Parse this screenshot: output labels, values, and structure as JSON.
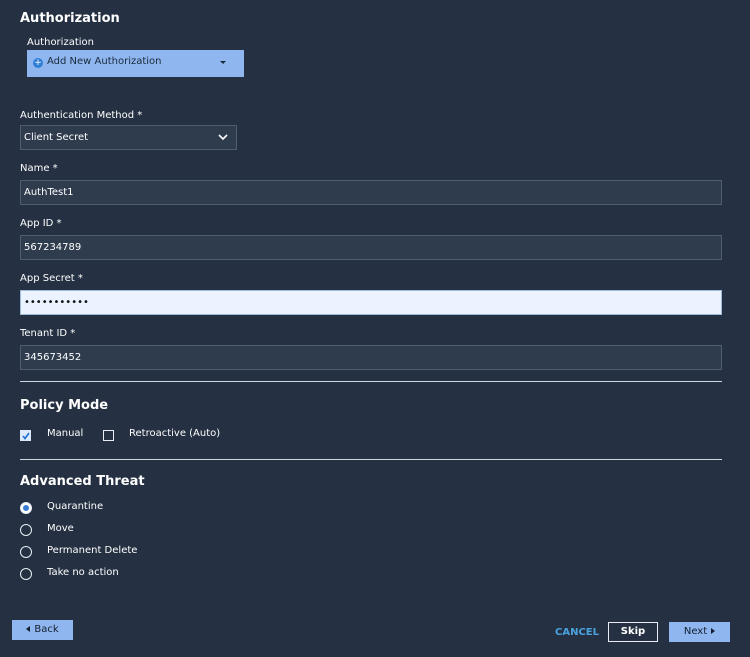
{
  "authorization": {
    "title": "Authorization",
    "field_label": "Authorization",
    "dropdown_value": "Add New Authorization"
  },
  "auth_method": {
    "label": "Authentication Method *",
    "value": "Client Secret"
  },
  "name": {
    "label": "Name *",
    "value": "AuthTest1"
  },
  "app_id": {
    "label": "App ID *",
    "value": "567234789"
  },
  "app_secret": {
    "label": "App Secret *",
    "value": "•••••••••••"
  },
  "tenant_id": {
    "label": "Tenant ID *",
    "value": "345673452"
  },
  "policy_mode": {
    "title": "Policy Mode",
    "options": [
      {
        "label": "Manual",
        "checked": true
      },
      {
        "label": "Retroactive (Auto)",
        "checked": false
      }
    ]
  },
  "advanced_threat": {
    "title": "Advanced Threat",
    "options": [
      {
        "label": "Quarantine",
        "selected": true
      },
      {
        "label": "Move",
        "selected": false
      },
      {
        "label": "Permanent Delete",
        "selected": false
      },
      {
        "label": "Take no action",
        "selected": false
      }
    ]
  },
  "footer": {
    "back_label": "Back",
    "cancel_label": "CANCEL",
    "skip_label": "Skip",
    "next_label": "Next"
  },
  "colors": {
    "background": "#253142",
    "accent_blue": "#8fb6ee",
    "cancel_link": "#4aa3df"
  }
}
